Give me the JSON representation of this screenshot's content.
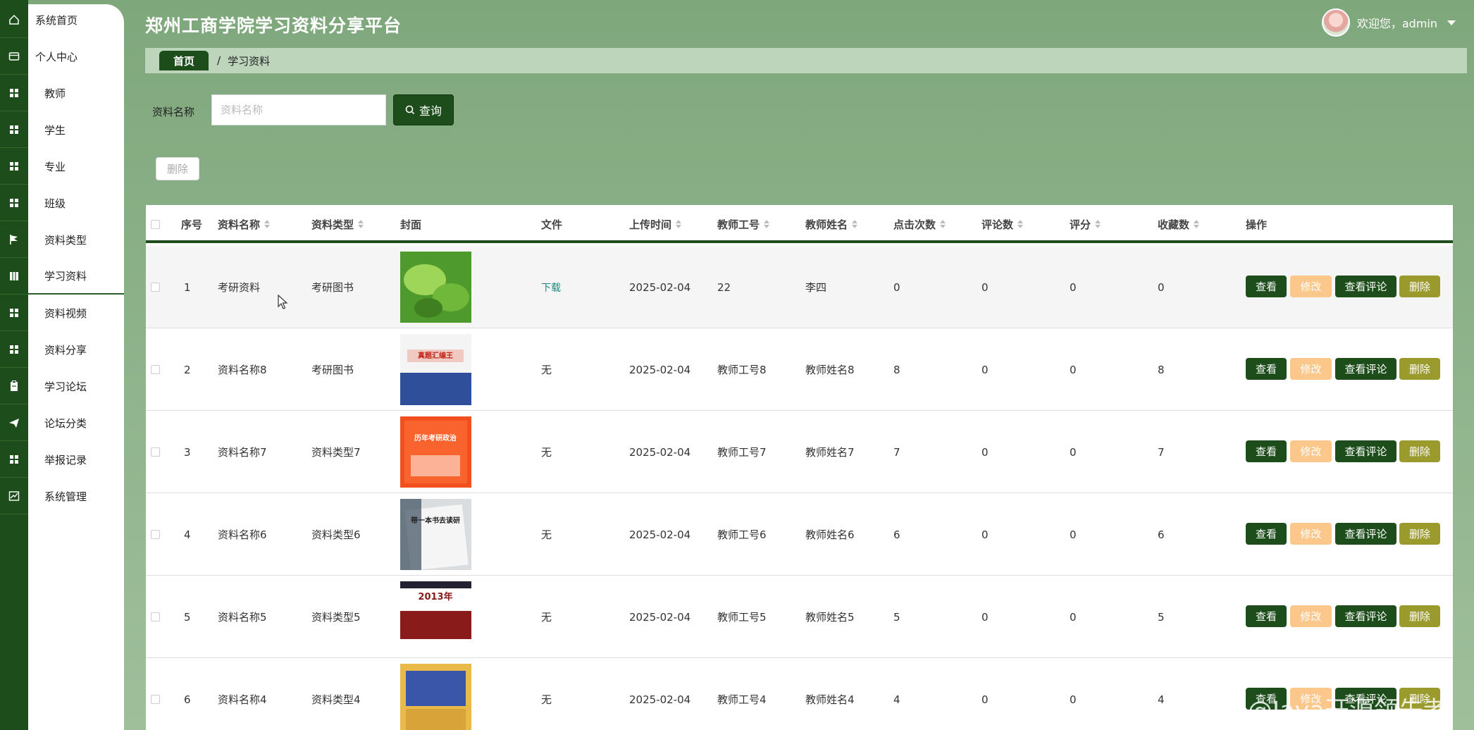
{
  "header": {
    "title": "郑州工商学院学习资料分享平台",
    "welcome": "欢迎您，admin"
  },
  "sidebar": {
    "items": [
      {
        "label": "系统首页",
        "icon": "home-icon"
      },
      {
        "label": "个人中心",
        "icon": "id-card-icon"
      },
      {
        "label": "教师",
        "icon": "grid-icon"
      },
      {
        "label": "学生",
        "icon": "grid-icon"
      },
      {
        "label": "专业",
        "icon": "grid-icon"
      },
      {
        "label": "班级",
        "icon": "grid-icon"
      },
      {
        "label": "资料类型",
        "icon": "flag-icon"
      },
      {
        "label": "学习资料",
        "icon": "book-icon"
      },
      {
        "label": "资料视频",
        "icon": "grid-icon"
      },
      {
        "label": "资料分享",
        "icon": "grid-icon"
      },
      {
        "label": "学习论坛",
        "icon": "clipboard-icon"
      },
      {
        "label": "论坛分类",
        "icon": "send-icon"
      },
      {
        "label": "举报记录",
        "icon": "grid-icon"
      },
      {
        "label": "系统管理",
        "icon": "chart-icon"
      }
    ]
  },
  "breadcrumb": {
    "home": "首页",
    "separator": "/",
    "current": "学习资料"
  },
  "search": {
    "label": "资料名称",
    "placeholder": "资料名称",
    "value": "",
    "button": "查询"
  },
  "toolbar": {
    "delete_label": "删除"
  },
  "table": {
    "columns": [
      "序号",
      "资料名称",
      "资料类型",
      "封面",
      "文件",
      "上传时间",
      "教师工号",
      "教师姓名",
      "点击次数",
      "评论数",
      "评分",
      "收藏数",
      "操作"
    ],
    "rows": [
      {
        "no": "1",
        "name": "考研资料",
        "type": "考研图书",
        "file": "下载",
        "time": "2025-02-04",
        "tid": "22",
        "tname": "李四",
        "clicks": "0",
        "comments": "0",
        "score": "0",
        "favs": "0"
      },
      {
        "no": "2",
        "name": "资料名称8",
        "type": "考研图书",
        "file": "无",
        "time": "2025-02-04",
        "tid": "教师工号8",
        "tname": "教师姓名8",
        "clicks": "8",
        "comments": "0",
        "score": "0",
        "favs": "8"
      },
      {
        "no": "3",
        "name": "资料名称7",
        "type": "资料类型7",
        "file": "无",
        "time": "2025-02-04",
        "tid": "教师工号7",
        "tname": "教师姓名7",
        "clicks": "7",
        "comments": "0",
        "score": "0",
        "favs": "7"
      },
      {
        "no": "4",
        "name": "资料名称6",
        "type": "资料类型6",
        "file": "无",
        "time": "2025-02-04",
        "tid": "教师工号6",
        "tname": "教师姓名6",
        "clicks": "6",
        "comments": "0",
        "score": "0",
        "favs": "6"
      },
      {
        "no": "5",
        "name": "资料名称5",
        "type": "资料类型5",
        "file": "无",
        "time": "2025-02-04",
        "tid": "教师工号5",
        "tname": "教师姓名5",
        "clicks": "5",
        "comments": "0",
        "score": "0",
        "favs": "5"
      },
      {
        "no": "6",
        "name": "资料名称4",
        "type": "资料类型4",
        "file": "无",
        "time": "2025-02-04",
        "tid": "教师工号4",
        "tname": "教师姓名4",
        "clicks": "4",
        "comments": "0",
        "score": "0",
        "favs": "4"
      }
    ],
    "actions": {
      "view": "查看",
      "edit": "修改",
      "comments": "查看评论",
      "delete": "删除"
    }
  },
  "covers": [
    {
      "label": "",
      "colors": [
        "#4f9a2c",
        "#9ed65a"
      ]
    },
    {
      "label": "真题汇编王",
      "colors": [
        "#f4f4f4",
        "#2f4f9a"
      ]
    },
    {
      "label": "历年考研政治",
      "colors": [
        "#f24f1e",
        "#ff7a3d"
      ]
    },
    {
      "label": "带一本书去读研",
      "colors": [
        "#d9dde0",
        "#3a4d5c"
      ]
    },
    {
      "label": "2013年",
      "colors": [
        "#ffffff",
        "#8a1b1b"
      ]
    },
    {
      "label": "",
      "colors": [
        "#e9b94a",
        "#3a56a8"
      ]
    }
  ],
  "watermark": "CSDN @Java开源领先者",
  "colors": {
    "primary": "#1d4d1a",
    "edit": "#fbc78a",
    "delete": "#9b9a2c",
    "download": "#1b8c7c"
  }
}
